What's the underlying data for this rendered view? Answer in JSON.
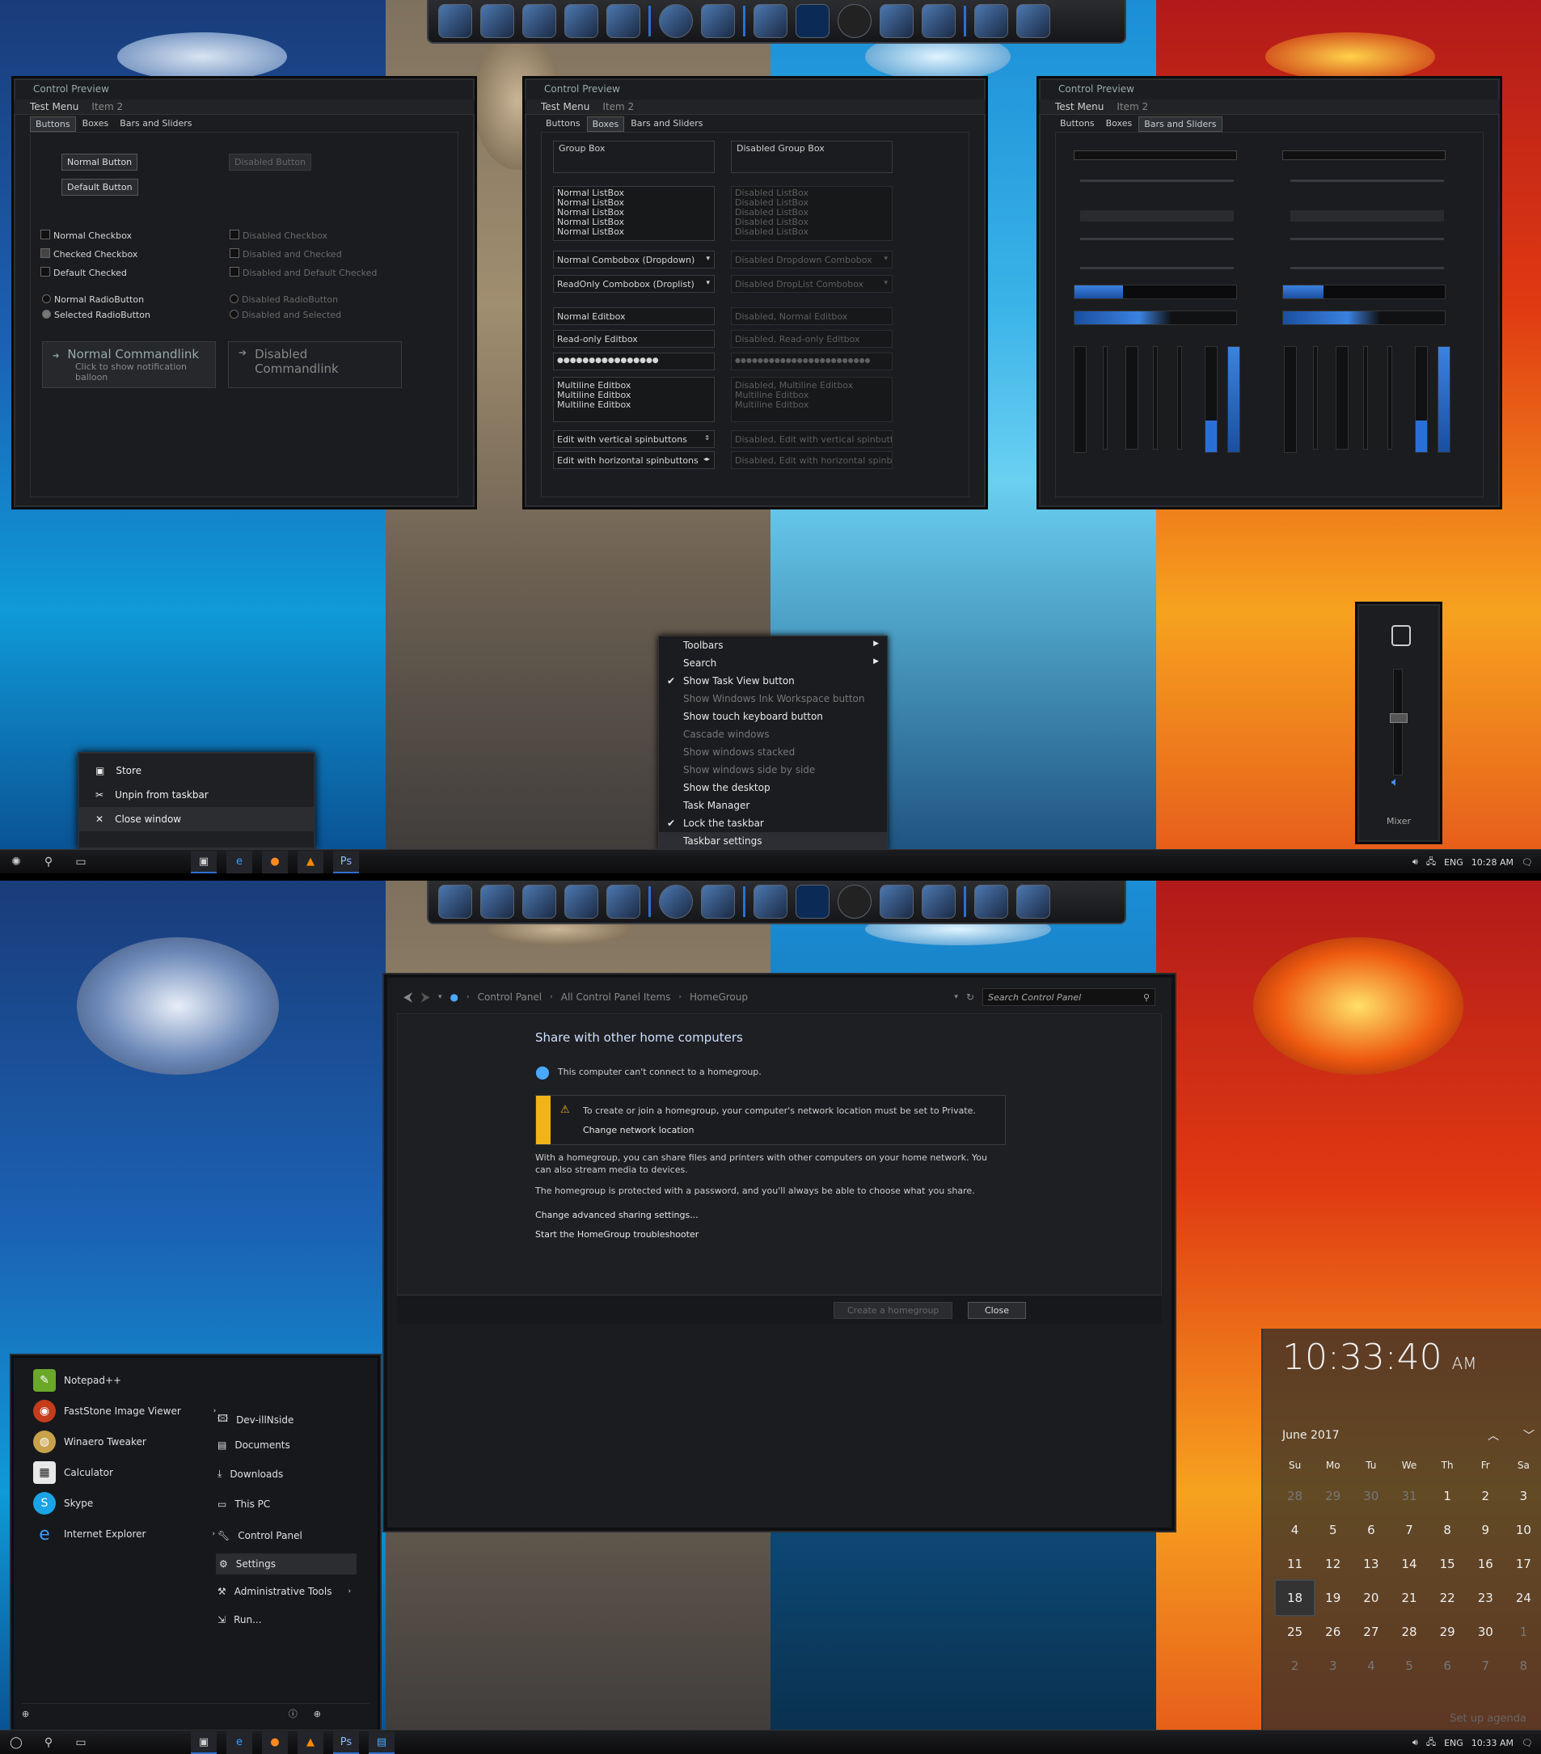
{
  "top": {
    "panels": [
      {
        "title": "Control Preview",
        "menu": [
          "Test Menu",
          "Item 2"
        ],
        "tabs": [
          "Buttons",
          "Boxes",
          "Bars and Sliders"
        ],
        "active_tab": 0,
        "buttons": {
          "normal": "Normal Button",
          "default": "Default Button",
          "disabled": "Disabled Button"
        },
        "checks": [
          "Normal Checkbox",
          "Checked Checkbox",
          "Default Checked"
        ],
        "checks_disabled": [
          "Disabled Checkbox",
          "Disabled and Checked",
          "Disabled and Default Checked"
        ],
        "radios": [
          "Normal RadioButton",
          "Selected RadioButton"
        ],
        "radios_disabled": [
          "Disabled RadioButton",
          "Disabled and Selected"
        ],
        "cmdlink": {
          "title": "Normal Commandlink",
          "sub": "Click to show notification balloon"
        },
        "cmdlink_disabled": {
          "title": "Disabled Commandlink"
        }
      },
      {
        "title": "Control Preview",
        "menu": [
          "Test Menu",
          "Item 2"
        ],
        "tabs": [
          "Buttons",
          "Boxes",
          "Bars and Sliders"
        ],
        "active_tab": 1,
        "group": "Group Box",
        "group_disabled": "Disabled Group Box",
        "listbox": [
          "Normal ListBox",
          "Normal ListBox",
          "Normal ListBox",
          "Normal ListBox",
          "Normal ListBox"
        ],
        "listbox_disabled": [
          "Disabled ListBox",
          "Disabled ListBox",
          "Disabled ListBox",
          "Disabled ListBox",
          "Disabled ListBox"
        ],
        "combo1": "Normal Combobox (Dropdown)",
        "combo2": "ReadOnly Combobox (Droplist)",
        "combo1_disabled": "Disabled Dropdown Combobox",
        "combo2_disabled": "Disabled DropList Combobox",
        "edit1": "Normal Editbox",
        "edit2": "Read-only Editbox",
        "password": "●●●●●●●●●●●●●●●●",
        "edit1_disabled": "Disabled, Normal Editbox",
        "edit2_disabled": "Disabled, Read-only Editbox",
        "password_disabled": "●●●●●●●●●●●●●●●●●●●●●●●●",
        "multiline": [
          "Multiline Editbox",
          "Multiline Editbox",
          "Multiline Editbox"
        ],
        "multiline_disabled": [
          "Disabled, Multiline Editbox",
          "Multiline Editbox",
          "Multiline Editbox"
        ],
        "spin_v": "Edit with vertical spinbuttons",
        "spin_h": "Edit with horizontal spinbuttons",
        "spin_v_disabled": "Disabled, Edit with vertical spinbutton",
        "spin_h_disabled": "Disabled, Edit with horizontal spinbutt"
      },
      {
        "title": "Control Preview",
        "menu": [
          "Test Menu",
          "Item 2"
        ],
        "tabs": [
          "Buttons",
          "Boxes",
          "Bars and Sliders"
        ],
        "active_tab": 2,
        "progress": [
          0.3,
          0.25
        ]
      }
    ],
    "context_menu": [
      {
        "label": "Toolbars",
        "arrow": true
      },
      {
        "label": "Search",
        "arrow": true
      },
      {
        "label": "Show Task View button",
        "checked": true
      },
      {
        "label": "Show Windows Ink Workspace button",
        "disabled": true
      },
      {
        "label": "Show touch keyboard button"
      },
      {
        "label": "Cascade windows",
        "disabled": true
      },
      {
        "label": "Show windows stacked",
        "disabled": true
      },
      {
        "label": "Show windows side by side",
        "disabled": true
      },
      {
        "label": "Show the desktop"
      },
      {
        "label": "Task Manager"
      },
      {
        "label": "Lock the taskbar",
        "checked": true
      },
      {
        "label": "Taskbar settings",
        "highlight": true
      }
    ],
    "jumplist": [
      "Store",
      "Unpin from taskbar",
      "Close window"
    ],
    "mixer": "Mixer",
    "volume_level": 0.55,
    "tray": {
      "lang": "ENG",
      "time": "10:28 AM"
    }
  },
  "bottom": {
    "controlpanel": {
      "breadcrumb": [
        "Control Panel",
        "All Control Panel Items",
        "HomeGroup"
      ],
      "search_placeholder": "Search Control Panel",
      "heading": "Share with other home computers",
      "status": "This computer can't connect to a homegroup.",
      "warning": "To create or join a homegroup, your computer's network location must be set to Private.",
      "warning_link": "Change network location",
      "para1": "With a homegroup, you can share files and printers with other computers on your home network. You can also stream media to devices.",
      "para2": "The homegroup is protected with a password, and you'll always be able to choose what you share.",
      "link1": "Change advanced sharing settings...",
      "link2": "Start the HomeGroup troubleshooter",
      "btn_create": "Create a homegroup",
      "btn_close": "Close"
    },
    "start": {
      "apps": [
        "Notepad++",
        "FastStone Image Viewer",
        "Winaero Tweaker",
        "Calculator",
        "Skype",
        "Internet Explorer"
      ],
      "places": [
        "Dev-illNside",
        "Documents",
        "Downloads",
        "This PC",
        "Control Panel",
        "Settings",
        "Administrative Tools",
        "Run..."
      ]
    },
    "clock": {
      "time": "10:33:40",
      "ampm": "AM",
      "month": "June 2017",
      "days": [
        "Su",
        "Mo",
        "Tu",
        "We",
        "Th",
        "Fr",
        "Sa"
      ],
      "dates": [
        "28",
        "29",
        "30",
        "31",
        "1",
        "2",
        "3",
        "4",
        "5",
        "6",
        "7",
        "8",
        "9",
        "10",
        "11",
        "12",
        "13",
        "14",
        "15",
        "16",
        "17",
        "18",
        "19",
        "20",
        "21",
        "22",
        "23",
        "24",
        "25",
        "26",
        "27",
        "28",
        "29",
        "30",
        "1",
        "2",
        "3",
        "4",
        "5",
        "6",
        "7",
        "8"
      ],
      "agenda": "Set up agenda"
    },
    "tray": {
      "lang": "ENG",
      "time": "10:33 AM"
    }
  },
  "colors": {
    "accent": "#2e6fd0",
    "warning": "#f0b419",
    "panel": "#1c1d20"
  }
}
